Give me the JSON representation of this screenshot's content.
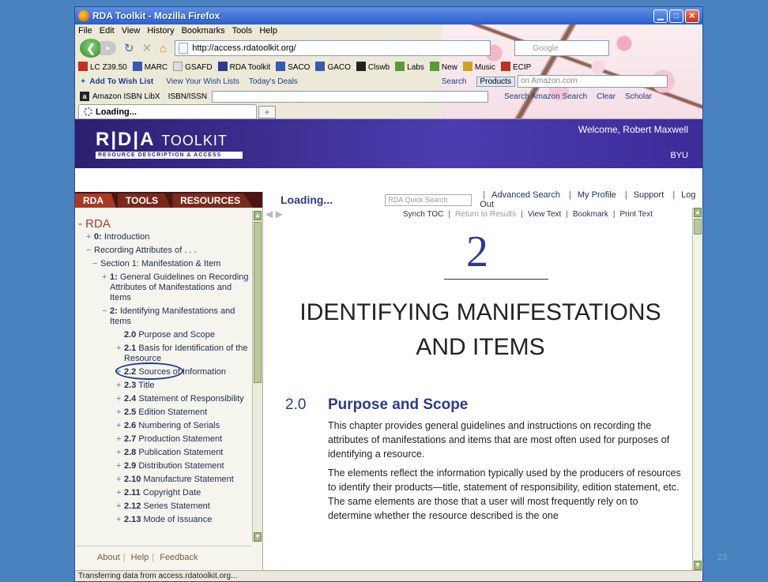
{
  "window": {
    "title": "RDA Toolkit - Mozilla Firefox"
  },
  "menu": [
    "File",
    "Edit",
    "View",
    "History",
    "Bookmarks",
    "Tools",
    "Help"
  ],
  "nav": {
    "url": "http://access.rdatoolkit.org/",
    "search_placeholder": "Google"
  },
  "bookmarks": [
    "LC Z39.50",
    "MARC",
    "GSAFD",
    "RDA Toolkit",
    "SACO",
    "GACO",
    "Clswb",
    "Labs",
    "New",
    "Music",
    "ECIP"
  ],
  "amazon": {
    "wish": "Add To Wish List",
    "view_wish": "View Your Wish Lists",
    "deals": "Today's Deals",
    "search_label": "Search",
    "products": "Products",
    "input": "on Amazon.com",
    "search_btn": "Search Amazon Search",
    "clear": "Clear",
    "scholar": "Scholar"
  },
  "libx": {
    "name": "Amazon ISBN LibX",
    "field": "ISBN/ISSN"
  },
  "tab": {
    "label": "Loading..."
  },
  "header": {
    "logo": "R|D|A",
    "toolkit": "TOOLKIT",
    "subtitle": "RESOURCE DESCRIPTION & ACCESS",
    "welcome": "Welcome, Robert Maxwell",
    "org": "BYU"
  },
  "left_tabs": [
    "RDA",
    "TOOLS",
    "RESOURCES"
  ],
  "toc": {
    "root": "RDA",
    "items": [
      {
        "mk": "+",
        "num": "0:",
        "text": "Introduction"
      },
      {
        "mk": "−",
        "num": "",
        "text": "Recording Attributes of . . ."
      },
      {
        "mk": "−",
        "num": "",
        "text": "Section 1: Manifestation & Item"
      },
      {
        "mk": "+",
        "num": "1:",
        "text": "General Guidelines on Recording Attributes of Manifestations and Items"
      },
      {
        "mk": "−",
        "num": "2:",
        "text": "Identifying Manifestations and Items"
      },
      {
        "mk": "",
        "num": "2.0",
        "text": "Purpose and Scope"
      },
      {
        "mk": "+",
        "num": "2.1",
        "text": "Basis for Identification of the Resource"
      },
      {
        "mk": "+",
        "num": "2.2",
        "text": "Sources of Information"
      },
      {
        "mk": "+",
        "num": "2.3",
        "text": "Title"
      },
      {
        "mk": "+",
        "num": "2.4",
        "text": "Statement of Responsibility"
      },
      {
        "mk": "+",
        "num": "2.5",
        "text": "Edition Statement"
      },
      {
        "mk": "+",
        "num": "2.6",
        "text": "Numbering of Serials"
      },
      {
        "mk": "+",
        "num": "2.7",
        "text": "Production Statement"
      },
      {
        "mk": "+",
        "num": "2.8",
        "text": "Publication Statement"
      },
      {
        "mk": "+",
        "num": "2.9",
        "text": "Distribution Statement"
      },
      {
        "mk": "+",
        "num": "2.10",
        "text": "Manufacture Statement"
      },
      {
        "mk": "+",
        "num": "2.11",
        "text": "Copyright Date"
      },
      {
        "mk": "+",
        "num": "2.12",
        "text": "Series Statement"
      },
      {
        "mk": "+",
        "num": "2.13",
        "text": "Mode of Issuance"
      }
    ]
  },
  "left_footer": [
    "About",
    "Help",
    "Feedback"
  ],
  "toolbar": {
    "loading": "Loading...",
    "quick_search": "RDA Quick Search",
    "links": [
      "Advanced Search",
      "My Profile",
      "Support",
      "Log Out"
    ]
  },
  "toolbar2": {
    "synch": "Synch TOC",
    "return": "Return to Results",
    "view_text": "View Text",
    "bookmark": "Bookmark",
    "print": "Print Text"
  },
  "doc": {
    "chapter_num": "2",
    "chapter_title": "IDENTIFYING MANIFESTATIONS AND ITEMS",
    "section_num": "2.0",
    "section_title": "Purpose and Scope",
    "para1": "This chapter provides general guidelines and instructions on recording the attributes of manifestations and items that are most often used for purposes of identifying a resource.",
    "para2": "The elements reflect the information typically used by the producers of resources to identify their products—title, statement of responsibility, edition statement, etc. The same elements are those that a user will most frequently rely on to determine whether the resource described is the one"
  },
  "status": "Transferring data from access.rdatoolkit.org...",
  "slide_number": "23"
}
